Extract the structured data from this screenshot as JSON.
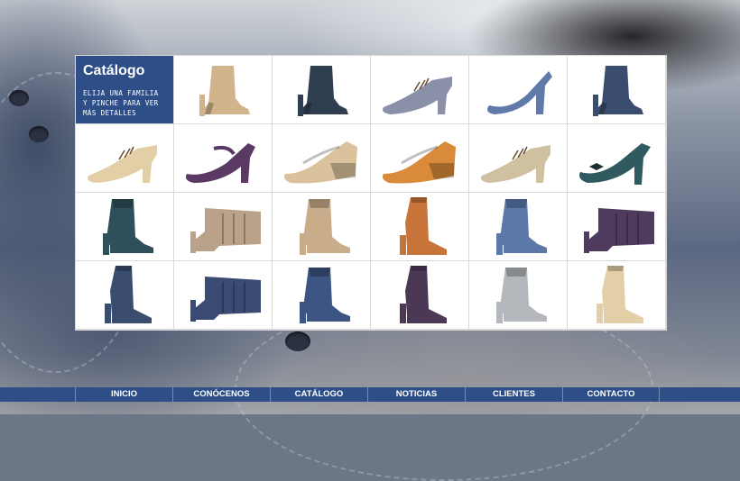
{
  "catalog": {
    "title": "Catálogo",
    "instructions": "ELIJA UNA FAMILIA Y PINCHE PARA VER MÁS DETALLES",
    "products": [
      {
        "kind": "ankle-boot",
        "color": "#d2b48c"
      },
      {
        "kind": "ankle-boot",
        "color": "#2f3f4f"
      },
      {
        "kind": "lace-pump",
        "color": "#8a90a8"
      },
      {
        "kind": "pump",
        "color": "#5f79a8"
      },
      {
        "kind": "ankle-boot",
        "color": "#3b4d6e"
      },
      {
        "kind": "lace-pump",
        "color": "#e2cfa6"
      },
      {
        "kind": "strap-pump",
        "color": "#5a3a64"
      },
      {
        "kind": "wedge",
        "color": "#d9c29c"
      },
      {
        "kind": "wedge",
        "color": "#d98a3a"
      },
      {
        "kind": "lace-pump",
        "color": "#cfc19f"
      },
      {
        "kind": "bow-pump",
        "color": "#2f5a60"
      },
      {
        "kind": "short-boot",
        "color": "#2f4f5a"
      },
      {
        "kind": "slouch-boot",
        "color": "#b9a18a"
      },
      {
        "kind": "short-boot",
        "color": "#c9ad8a"
      },
      {
        "kind": "tall-boot",
        "color": "#c8733a"
      },
      {
        "kind": "short-boot",
        "color": "#5b78a8"
      },
      {
        "kind": "slouch-boot",
        "color": "#4f3b5e"
      },
      {
        "kind": "tall-boot",
        "color": "#3b4d6e"
      },
      {
        "kind": "slouch-boot",
        "color": "#3b4a72"
      },
      {
        "kind": "short-boot",
        "color": "#3d5582"
      },
      {
        "kind": "tall-boot",
        "color": "#4b3855"
      },
      {
        "kind": "short-boot",
        "color": "#b4b8bc"
      },
      {
        "kind": "tall-boot",
        "color": "#e2cfa8"
      }
    ]
  },
  "nav": {
    "items": [
      "INICIO",
      "CONÓCENOS",
      "CATÁLOGO",
      "NOTICIAS",
      "CLIENTES",
      "CONTACTO"
    ]
  },
  "colors": {
    "brand_blue": "#2d4e86",
    "panel_white": "#ffffff"
  }
}
